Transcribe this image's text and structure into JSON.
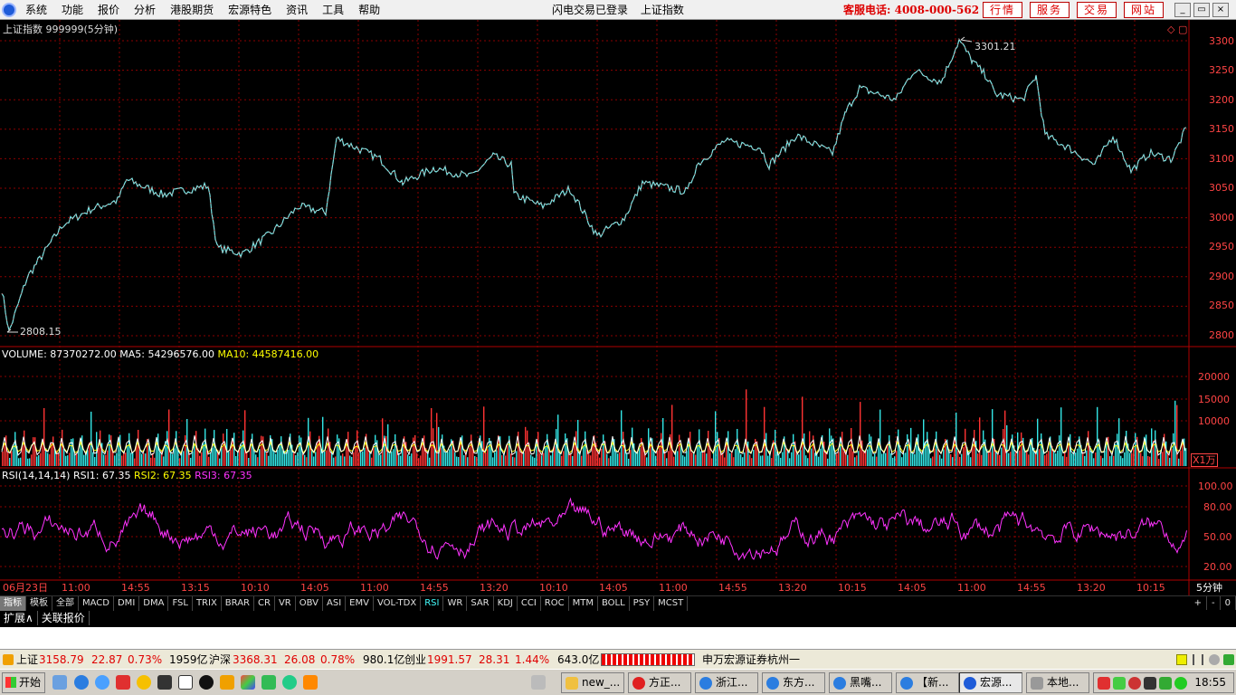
{
  "menu": [
    "系统",
    "功能",
    "报价",
    "分析",
    "港股期货",
    "宏源特色",
    "资讯",
    "工具",
    "帮助"
  ],
  "title_center": [
    "闪电交易已登录",
    "上证指数"
  ],
  "hotline": "客服电话: 4008-000-562",
  "title_buttons": [
    "行情",
    "服务",
    "交易",
    "网站"
  ],
  "window_buttons": [
    "_",
    "▭",
    "×"
  ],
  "chart_title": "上证指数 999999(5分钟)",
  "price_axis": [
    "3300",
    "3250",
    "3200",
    "3150",
    "3100",
    "3050",
    "3000",
    "2950",
    "2900",
    "2850",
    "2800"
  ],
  "price_high_label": "3301.21",
  "price_low_label": "2808.15",
  "volume_header": {
    "volume": "VOLUME: 87370272.00",
    "ma5": "MA5: 54296576.00",
    "ma10": "MA10: 44587416.00"
  },
  "volume_axis": [
    "20000",
    "15000",
    "10000"
  ],
  "volume_unit": "X1万",
  "rsi_header": {
    "name": "RSI(14,14,14)",
    "rsi1": "RSI1: 67.35",
    "rsi2": "RSI2: 67.35",
    "rsi3": "RSI3: 67.35"
  },
  "rsi_axis": [
    "100.00",
    "80.00",
    "50.00",
    "20.00"
  ],
  "time_axis": [
    "06月23日",
    "11:00",
    "14:55",
    "13:15",
    "10:10",
    "14:05",
    "11:00",
    "14:55",
    "13:20",
    "10:10",
    "14:05",
    "11:00",
    "14:55",
    "13:20",
    "10:15",
    "14:05",
    "11:00",
    "14:55",
    "13:20",
    "10:15"
  ],
  "period_label": "5分钟",
  "indicator_tabs": [
    "指标",
    "模板",
    "全部",
    "MACD",
    "DMI",
    "DMA",
    "FSL",
    "TRIX",
    "BRAR",
    "CR",
    "VR",
    "OBV",
    "ASI",
    "EMV",
    "VOL-TDX",
    "RSI",
    "WR",
    "SAR",
    "KDJ",
    "CCI",
    "ROC",
    "MTM",
    "BOLL",
    "PSY",
    "MCST"
  ],
  "active_tab": "RSI",
  "tab_controls": [
    "+",
    "-",
    "0"
  ],
  "sub_tabs": [
    "扩展∧",
    "关联报价"
  ],
  "status": {
    "sh_name": "上证",
    "sh_price": "3158.79",
    "sh_change": "22.87",
    "sh_pct": "0.73%",
    "sh_amount": "1959亿",
    "hs_name": "沪深",
    "hs_price": "3368.31",
    "hs_change": "26.08",
    "hs_pct": "0.78%",
    "hs_amount": "980.1亿",
    "cy_name": "创业",
    "cy_price": "1991.57",
    "cy_change": "28.31",
    "cy_pct": "1.44%",
    "cy_amount": "643.0亿",
    "broker": "申万宏源证券杭州一"
  },
  "taskbar": {
    "start": "开始",
    "tasks": [
      "new_...",
      "方正...",
      "浙江...",
      "东方...",
      "黑嘴...",
      "【新...",
      "宏源...",
      "本地..."
    ],
    "clock": "18:55"
  },
  "colors": {
    "grid": "#8b0000",
    "price_line": "#7fe7e7",
    "price_up": "#ff3333",
    "volume_up": "#ff3333",
    "volume_down": "#33e6e6",
    "ma5": "#ffffff",
    "ma10": "#ffff00",
    "rsi_line": "#ff33ff",
    "axis_text": "#ff4444"
  }
}
